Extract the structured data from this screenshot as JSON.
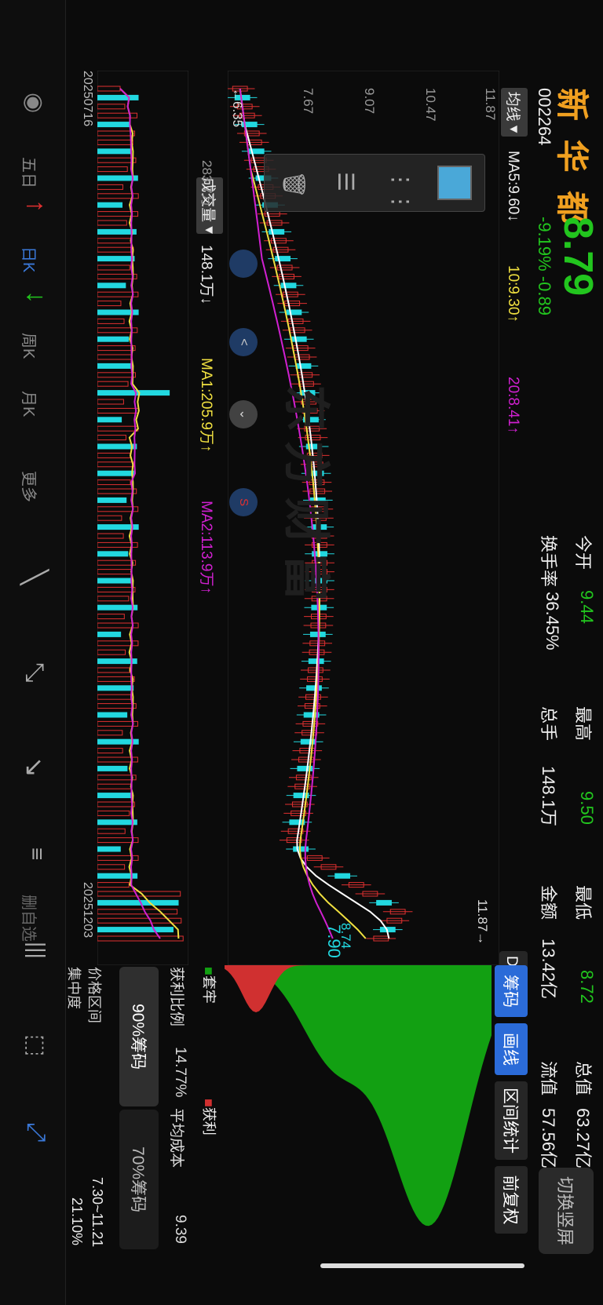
{
  "header": {
    "name": "新 华 都",
    "code": "002264",
    "price": "8.79",
    "change_pct": "-9.19%",
    "change_abs": "-0.89",
    "open_label": "今开",
    "open_value": "9.44",
    "high_label": "最高",
    "high_value": "9.50",
    "low_label": "最低",
    "low_value": "8.72",
    "total_value_label": "总值",
    "total_value": "63.27亿",
    "turnover_label": "换手率",
    "turnover_value": "36.45%",
    "volume_label": "总手",
    "volume_value": "148.1万",
    "amount_label": "金额",
    "amount_value": "13.42亿",
    "float_value_label": "流值",
    "float_value": "57.56亿",
    "switch_button": "切换竖屏"
  },
  "kline": {
    "ma_selector": "均线",
    "ma5": "MA5:9.60↓",
    "ma10": "10:9.30↑",
    "ma20": "20:8.41↑",
    "dk_label": "DK点",
    "y_ticks": [
      "11.87",
      "10.47",
      "9.07",
      "7.67",
      "6.35"
    ],
    "high_marker": "11.87→",
    "low_marker": "←6.35",
    "last_label": "8.74",
    "cost_label": "7.90",
    "watermark": "东方财富",
    "marker_s": "S"
  },
  "volume": {
    "selector": "成交量",
    "max": "283.7万",
    "vol": "148.1万↓",
    "ma1": "MA1:205.9万↑",
    "ma2": "MA2:113.9万↑",
    "date_start": "20250716",
    "date_end": "20251203"
  },
  "chips": {
    "tabs": [
      "筹码",
      "画线",
      "区间统计",
      "前复权"
    ],
    "legend_loss": "套牢",
    "legend_profit": "获利",
    "profit_ratio_label": "获利比例",
    "profit_ratio_value": "14.77%",
    "avg_cost_label": "平均成本",
    "avg_cost_value": "9.39",
    "btn_90": "90%筹码",
    "btn_70": "70%筹码",
    "range_label": "价格区间",
    "range_value": "7.30~11.21",
    "conc_label": "集中度",
    "conc_value": "21.10%"
  },
  "toolbar": {
    "items": [
      "五日",
      "日K",
      "周K",
      "月K",
      "更多"
    ],
    "right_label": "删自选"
  },
  "colors": {
    "up": "#e03030",
    "down": "#22d8e0",
    "ma5": "#ffffff",
    "ma10": "#f0e040",
    "ma20": "#d020d0",
    "chip_green": "#12a012",
    "chip_red": "#d03030"
  }
}
